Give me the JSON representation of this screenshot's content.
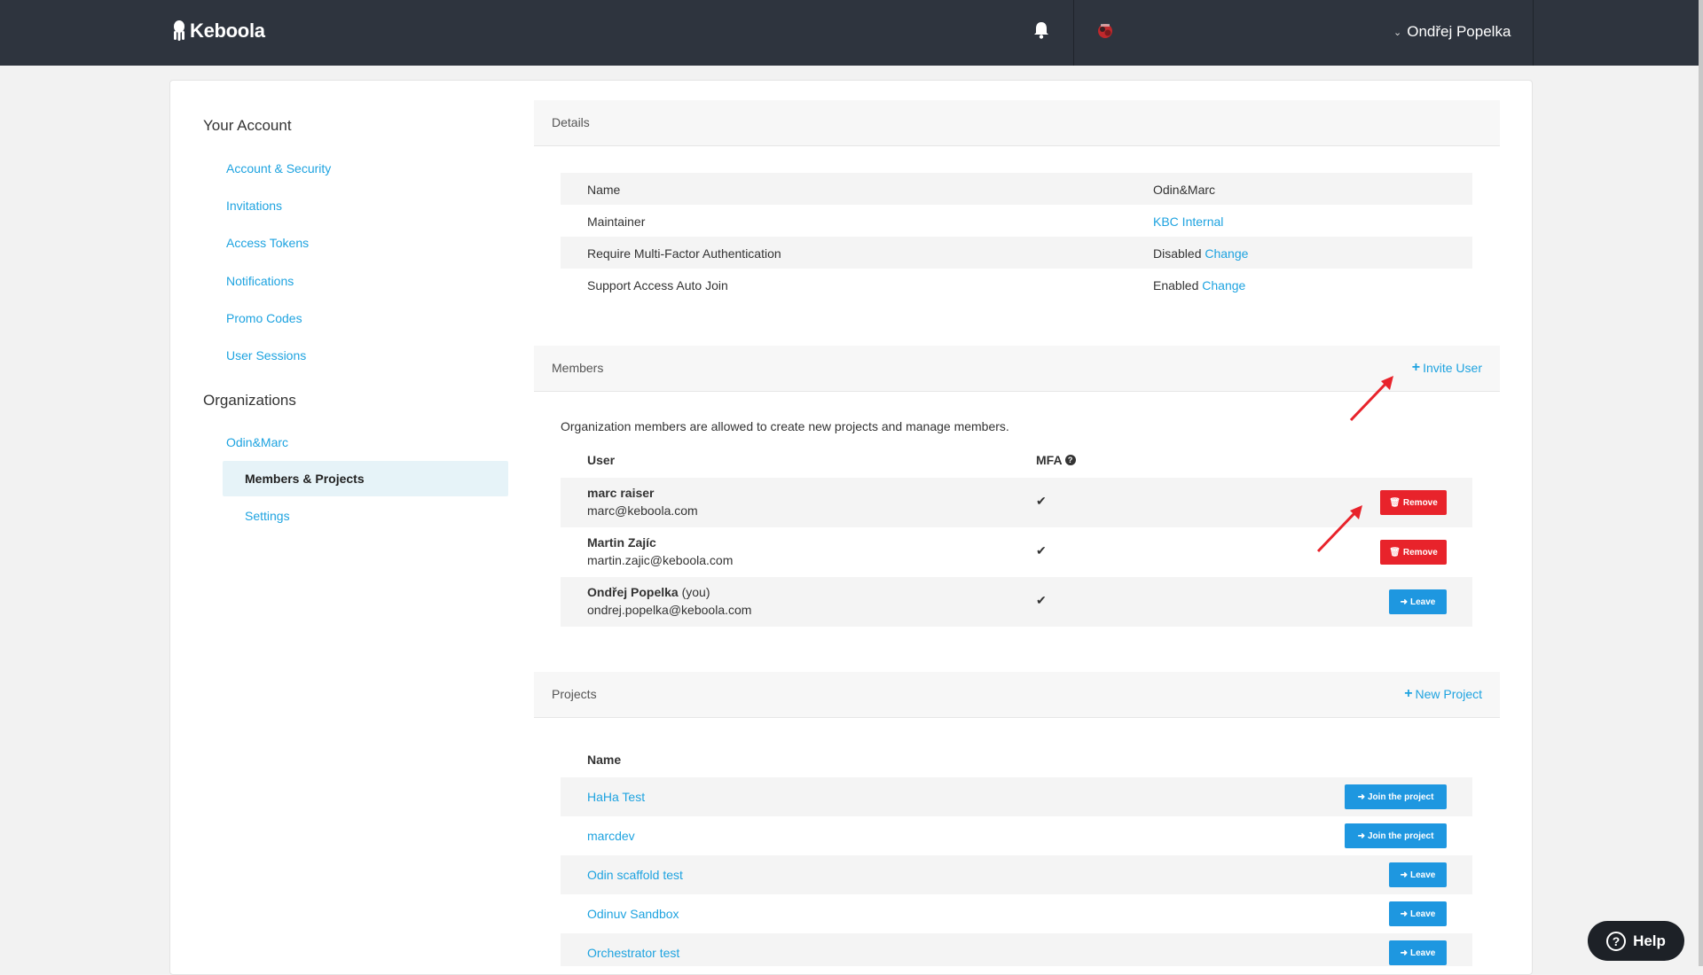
{
  "navbar": {
    "brand": "Keboola",
    "user_name": "Ondřej Popelka"
  },
  "sidebar": {
    "account_heading": "Your Account",
    "account_links": [
      "Account & Security",
      "Invitations",
      "Access Tokens",
      "Notifications",
      "Promo Codes",
      "User Sessions"
    ],
    "org_heading": "Organizations",
    "org_name": "Odin&Marc",
    "org_sub_links": [
      "Members & Projects",
      "Settings"
    ]
  },
  "details": {
    "title": "Details",
    "rows": [
      {
        "label": "Name",
        "value": "Odin&Marc",
        "link": ""
      },
      {
        "label": "Maintainer",
        "value": "",
        "link": "KBC Internal"
      },
      {
        "label": "Require Multi-Factor Authentication",
        "value": "Disabled",
        "link": "Change"
      },
      {
        "label": "Support Access Auto Join",
        "value": "Enabled",
        "link": "Change"
      }
    ]
  },
  "members": {
    "title": "Members",
    "action": "Invite User",
    "description": "Organization members are allowed to create new projects and manage members.",
    "col_user": "User",
    "col_mfa": "MFA",
    "rows": [
      {
        "name": "marc raiser",
        "suffix": "",
        "email": "marc@keboola.com",
        "mfa": "✔",
        "button": "Remove"
      },
      {
        "name": "Martin Zajíc",
        "suffix": "",
        "email": "martin.zajic@keboola.com",
        "mfa": "✔",
        "button": "Remove"
      },
      {
        "name": "Ondřej Popelka",
        "suffix": "(you)",
        "email": "ondrej.popelka@keboola.com",
        "mfa": "✔",
        "button": "Leave"
      }
    ]
  },
  "projects": {
    "title": "Projects",
    "action": "New Project",
    "col_name": "Name",
    "rows": [
      {
        "name": "HaHa Test",
        "button": "Join the project"
      },
      {
        "name": "marcdev",
        "button": "Join the project"
      },
      {
        "name": "Odin scaffold test",
        "button": "Leave"
      },
      {
        "name": "Odinuv Sandbox",
        "button": "Leave"
      },
      {
        "name": "Orchestrator test",
        "button": "Leave"
      }
    ]
  },
  "help": {
    "label": "Help"
  },
  "colors": {
    "navbar": "#2e343e",
    "link": "#1ea3e0",
    "danger": "#e8232b",
    "primary": "#1e97e0",
    "active_bg": "#e6f3f8"
  }
}
